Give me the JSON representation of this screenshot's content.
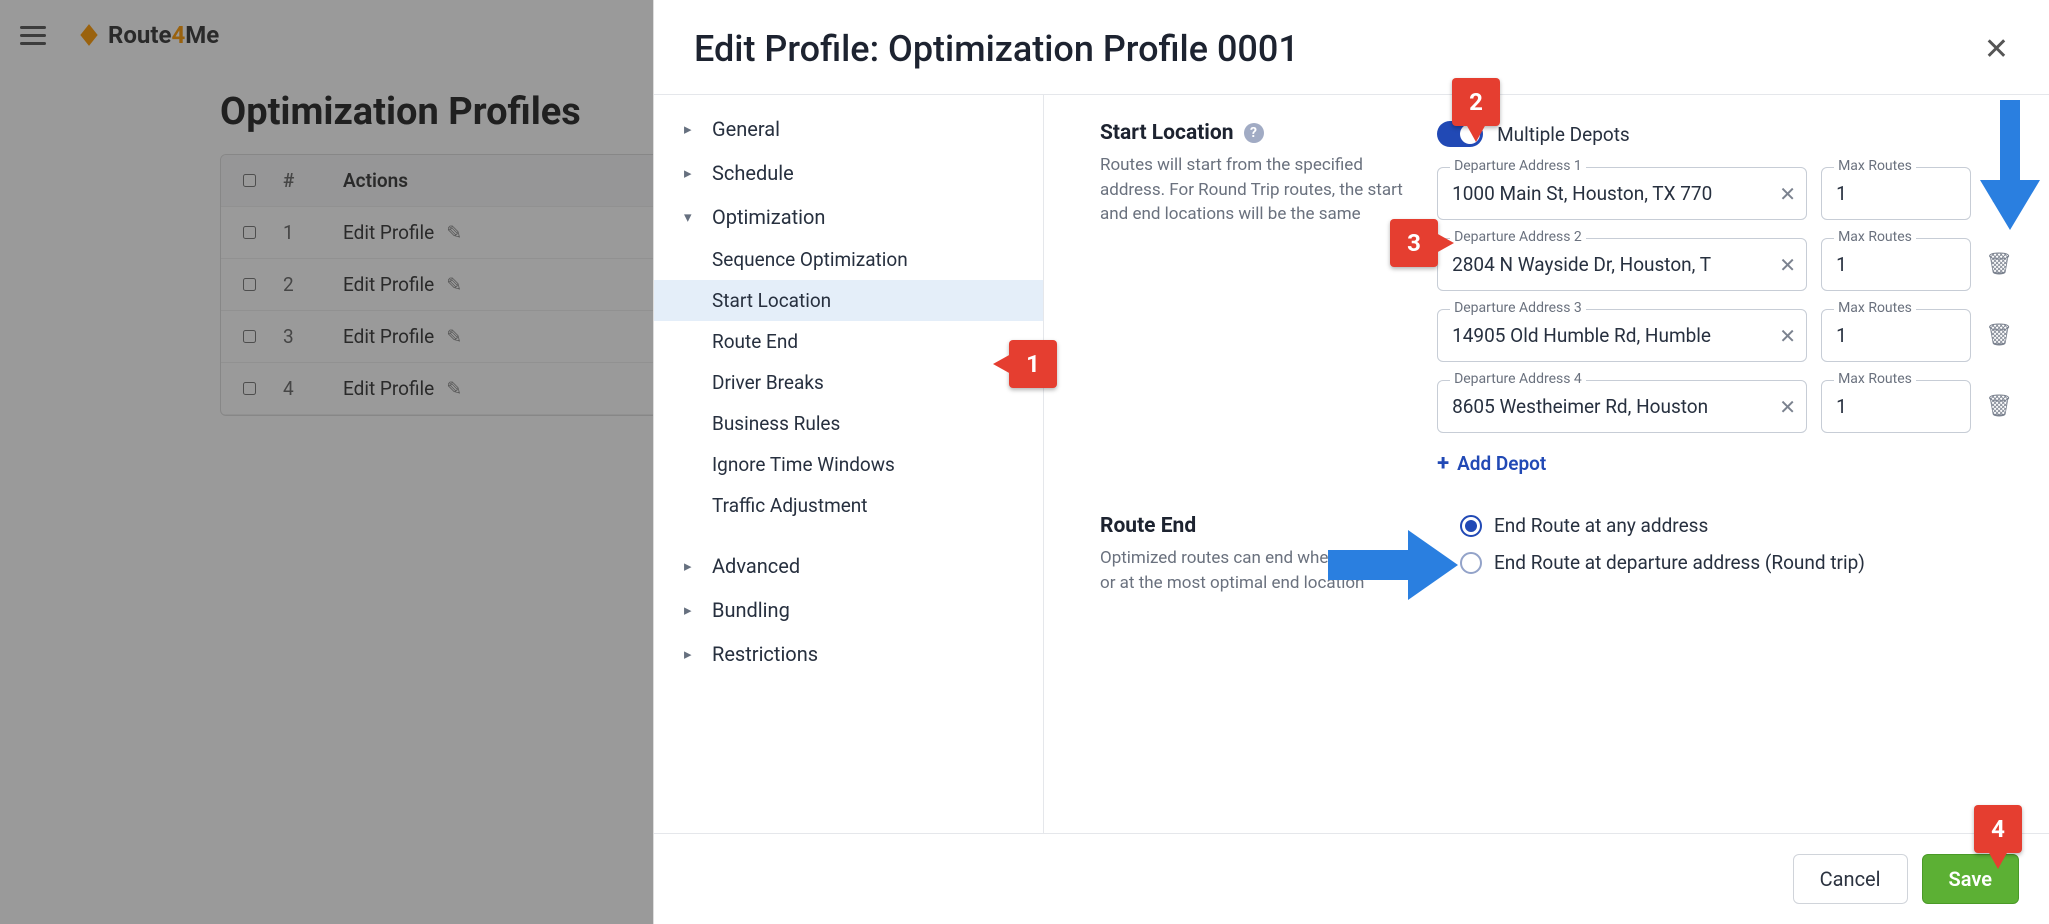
{
  "bg": {
    "page_title": "Optimization Profiles",
    "col_actions": "Actions",
    "rows": [
      {
        "num": "1",
        "name": "Edit Profile"
      },
      {
        "num": "2",
        "name": "Edit Profile"
      },
      {
        "num": "3",
        "name": "Edit Profile"
      },
      {
        "num": "4",
        "name": "Edit Profile"
      }
    ],
    "logo_part1": "Route",
    "logo_part2": "4",
    "logo_part3": "Me"
  },
  "modal": {
    "title": "Edit Profile: Optimization Profile 0001",
    "cancel": "Cancel",
    "save": "Save"
  },
  "nav": {
    "general": "General",
    "schedule": "Schedule",
    "optimization": "Optimization",
    "sequence_optimization": "Sequence Optimization",
    "start_location": "Start Location",
    "route_end": "Route End",
    "driver_breaks": "Driver Breaks",
    "business_rules": "Business Rules",
    "ignore_time_windows": "Ignore Time Windows",
    "traffic_adjustment": "Traffic Adjustment",
    "advanced": "Advanced",
    "bundling": "Bundling",
    "restrictions": "Restrictions"
  },
  "start_location": {
    "title": "Start Location",
    "desc": "Routes will start from the specified address. For Round Trip routes, the start and end locations will be the same",
    "toggle_label": "Multiple Depots",
    "add_depot": "Add Depot",
    "depots": [
      {
        "addr_label": "Departure Address 1",
        "addr_value": "1000 Main St, Houston, TX 770",
        "max_label": "Max Routes",
        "max_value": "1"
      },
      {
        "addr_label": "Departure Address 2",
        "addr_value": "2804 N Wayside Dr, Houston, T",
        "max_label": "Max Routes",
        "max_value": "1"
      },
      {
        "addr_label": "Departure Address 3",
        "addr_value": "14905 Old Humble Rd, Humble",
        "max_label": "Max Routes",
        "max_value": "1"
      },
      {
        "addr_label": "Departure Address 4",
        "addr_value": "8605 Westheimer Rd, Houston",
        "max_label": "Max Routes",
        "max_value": "1"
      }
    ]
  },
  "route_end": {
    "title": "Route End",
    "desc": "Optimized routes can end where they start or at the most optimal end location",
    "opt1": "End Route at any address",
    "opt2": "End Route at departure address (Round trip)"
  },
  "annotations": {
    "n1": "1",
    "n2": "2",
    "n3": "3",
    "n4": "4"
  }
}
